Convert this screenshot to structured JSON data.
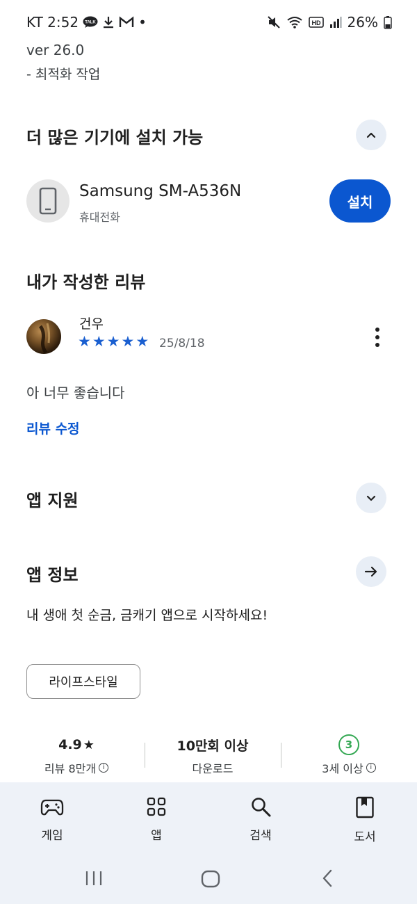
{
  "status_bar": {
    "carrier_time": "KT 2:52",
    "talk_badge": "TALK",
    "dot": "•",
    "hd_badge": "HD",
    "battery": "26%"
  },
  "version": {
    "label": "ver 26.0",
    "note": "- 최적화 작업"
  },
  "devices_section": {
    "title": "더 많은 기기에 설치 가능",
    "device_name": "Samsung SM-A536N",
    "device_type": "휴대전화",
    "install_label": "설치"
  },
  "review_section": {
    "title": "내가 작성한 리뷰",
    "reviewer": "건우",
    "rating": 5,
    "stars": [
      "★",
      "★",
      "★",
      "★",
      "★"
    ],
    "date": "25/8/18",
    "text": "아 너무 좋습니다",
    "edit_label": "리뷰 수정"
  },
  "app_support": {
    "title": "앱 지원"
  },
  "app_info": {
    "title": "앱 정보",
    "description": "내 생애 첫 순금, 금캐기 앱으로 시작하세요!",
    "category_chip": "라이프스타일"
  },
  "stats": {
    "rating_value": "4.9",
    "rating_star": "★",
    "rating_label": "리뷰 8만개",
    "downloads_value": "10만회 이상",
    "downloads_label": "다운로드",
    "age_value": "3",
    "age_label": "3세 이상",
    "info_glyph": "i"
  },
  "bottom_nav": [
    {
      "label": "게임",
      "icon": "gamepad-icon"
    },
    {
      "label": "앱",
      "icon": "apps-grid-icon"
    },
    {
      "label": "검색",
      "icon": "search-icon"
    },
    {
      "label": "도서",
      "icon": "book-icon"
    }
  ],
  "colors": {
    "accent_blue": "#0b57d0",
    "star_blue": "#1a5fd0",
    "age_green": "#34a853",
    "nav_background": "#eef2f8"
  }
}
